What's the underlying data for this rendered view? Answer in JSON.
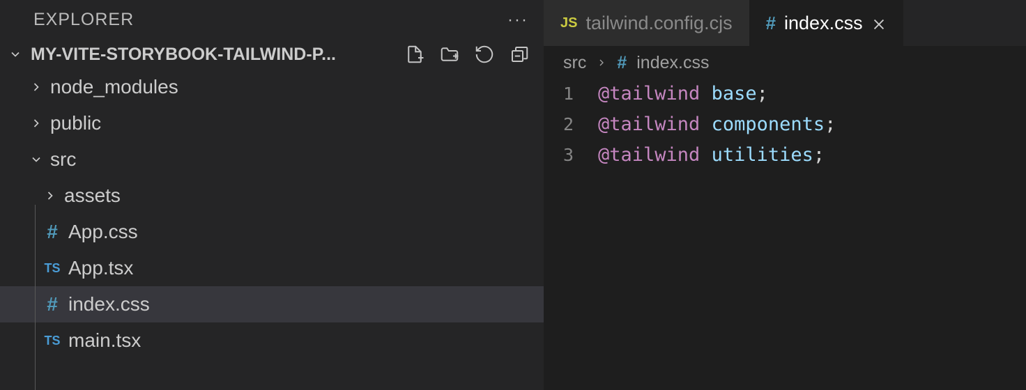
{
  "sidebar": {
    "title": "EXPLORER",
    "project": "MY-VITE-STORYBOOK-TAILWIND-P...",
    "tree": {
      "node_modules": "node_modules",
      "public": "public",
      "src": "src",
      "assets": "assets",
      "app_css": "App.css",
      "app_tsx": "App.tsx",
      "index_css": "index.css",
      "main_tsx": "main.tsx"
    }
  },
  "tabs": {
    "inactive": "tailwind.config.cjs",
    "active": "index.css"
  },
  "breadcrumb": {
    "src": "src",
    "file": "index.css"
  },
  "code": {
    "lines": [
      {
        "n": "1",
        "at": "@tailwind",
        "ident": "base",
        "punc": ";"
      },
      {
        "n": "2",
        "at": "@tailwind",
        "ident": "components",
        "punc": ";"
      },
      {
        "n": "3",
        "at": "@tailwind",
        "ident": "utilities",
        "punc": ";"
      }
    ]
  }
}
